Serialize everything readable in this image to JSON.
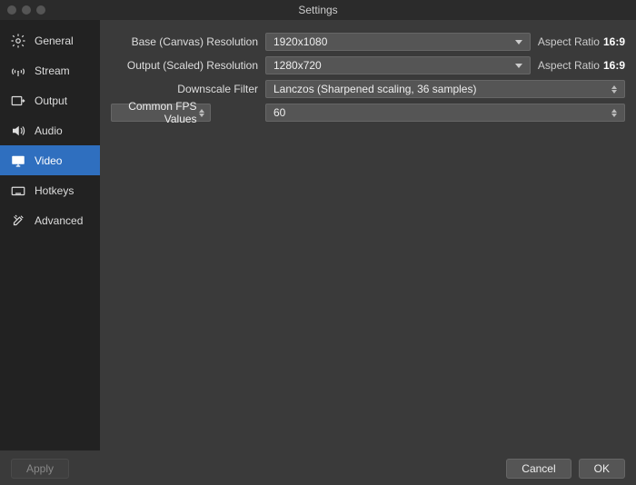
{
  "window": {
    "title": "Settings"
  },
  "sidebar": {
    "items": [
      {
        "label": "General"
      },
      {
        "label": "Stream"
      },
      {
        "label": "Output"
      },
      {
        "label": "Audio"
      },
      {
        "label": "Video"
      },
      {
        "label": "Hotkeys"
      },
      {
        "label": "Advanced"
      }
    ],
    "selected_index": 4
  },
  "video": {
    "base_resolution": {
      "label": "Base (Canvas) Resolution",
      "value": "1920x1080",
      "aspect_label": "Aspect Ratio",
      "aspect_value": "16:9"
    },
    "output_resolution": {
      "label": "Output (Scaled) Resolution",
      "value": "1280x720",
      "aspect_label": "Aspect Ratio",
      "aspect_value": "16:9"
    },
    "downscale_filter": {
      "label": "Downscale Filter",
      "value": "Lanczos (Sharpened scaling, 36 samples)"
    },
    "fps": {
      "mode_label": "Common FPS Values",
      "value": "60"
    }
  },
  "footer": {
    "apply": "Apply",
    "cancel": "Cancel",
    "ok": "OK"
  }
}
